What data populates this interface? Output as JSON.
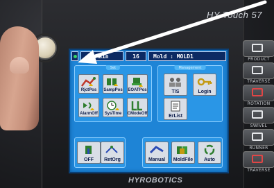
{
  "device": {
    "brand_top": "HY Touch 57",
    "brand_bottom": "HYROBOTICS"
  },
  "topbar": {
    "screen_name": "Main",
    "number": "16",
    "mold_label": "Mold : MOLD1"
  },
  "panels": {
    "left_title": "Set",
    "right_title": "Management"
  },
  "tiles": {
    "rjct_pos": "RjctPos",
    "samp_pos": "SampPos",
    "eoat_pos": "EOATPos",
    "alarm_off": "AlarmOff",
    "sys_time": "SysTime",
    "cmode_off": "CModeOff",
    "ts": "T/S",
    "login": "Login",
    "erlist": "ErList",
    "off": "OFF",
    "ret_org": "RetOrg",
    "manual": "Manual",
    "mold_file": "MoldFile",
    "auto": "Auto"
  },
  "hw_buttons": [
    {
      "label": "PRODUCT"
    },
    {
      "label": "TRAVERSE"
    },
    {
      "label": "ROTATION"
    },
    {
      "label": "SWIVEL"
    },
    {
      "label": "RUNNER"
    },
    {
      "label": "TRAVERSE"
    }
  ],
  "colors": {
    "screen_bg": "#1e84d6",
    "topbar_bg": "#0c2a63",
    "status_led": "#37d36a",
    "accent_red": "#e04646"
  }
}
